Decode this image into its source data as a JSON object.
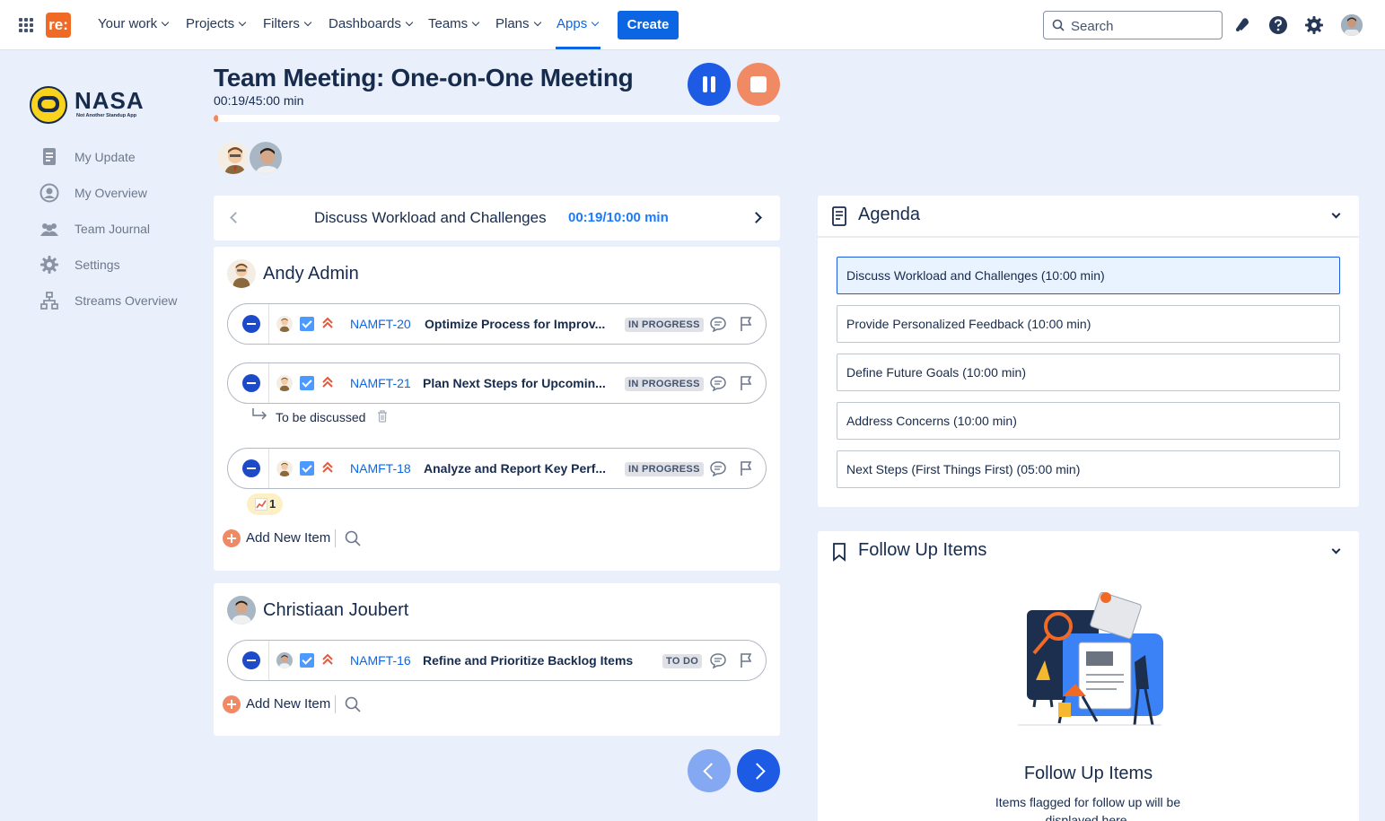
{
  "topnav": {
    "logo_text": "re:",
    "items": [
      {
        "label": "Your work"
      },
      {
        "label": "Projects"
      },
      {
        "label": "Filters"
      },
      {
        "label": "Dashboards"
      },
      {
        "label": "Teams"
      },
      {
        "label": "Plans"
      },
      {
        "label": "Apps",
        "active": true
      }
    ],
    "create_label": "Create",
    "search_placeholder": "Search",
    "icons": [
      "app-switcher-icon",
      "notifications-icon",
      "help-icon",
      "settings-icon",
      "profile-avatar"
    ]
  },
  "sidebar": {
    "logo_text": "NASA",
    "logo_subtitle": "Not Another Standup App",
    "items": [
      {
        "label": "My Update",
        "icon": "document-icon"
      },
      {
        "label": "My Overview",
        "icon": "user-circle-icon"
      },
      {
        "label": "Team Journal",
        "icon": "people-icon"
      },
      {
        "label": "Settings",
        "icon": "gear-icon"
      },
      {
        "label": "Streams Overview",
        "icon": "hierarchy-icon"
      }
    ]
  },
  "meeting": {
    "title": "Team Meeting: One-on-One Meeting",
    "elapsed": "00:19/45:00 min",
    "progress_fraction": 0.007,
    "participants": [
      "Andy Admin",
      "Christiaan Joubert"
    ]
  },
  "topic": {
    "name": "Discuss Workload and Challenges",
    "time": "00:19/10:00 min"
  },
  "people": [
    {
      "name": "Andy Admin",
      "items": [
        {
          "key": "NAMFT-20",
          "summary": "Optimize Process for Improv...",
          "status": "IN PROGRESS"
        },
        {
          "key": "NAMFT-21",
          "summary": "Plan Next Steps for Upcomin...",
          "status": "IN PROGRESS",
          "note": "To be discussed"
        },
        {
          "key": "NAMFT-18",
          "summary": "Analyze and Report Key Perf...",
          "status": "IN PROGRESS",
          "reaction_count": "1"
        }
      ],
      "add_label": "Add New Item"
    },
    {
      "name": "Christiaan Joubert",
      "items": [
        {
          "key": "NAMFT-16",
          "summary": "Refine and Prioritize Backlog Items",
          "status": "TO DO"
        }
      ],
      "add_label": "Add New Item"
    }
  ],
  "agenda": {
    "title": "Agenda",
    "items": [
      {
        "label": "Discuss Workload and Challenges (10:00 min)",
        "active": true
      },
      {
        "label": "Provide Personalized Feedback (10:00 min)"
      },
      {
        "label": "Define Future Goals (10:00 min)"
      },
      {
        "label": "Address Concerns (10:00 min)"
      },
      {
        "label": "Next Steps (First Things First) (05:00 min)"
      }
    ]
  },
  "follow_up": {
    "header": "Follow Up Items",
    "empty_title": "Follow Up Items",
    "empty_desc": "Items flagged for follow up will be displayed here."
  },
  "colors": {
    "brand_blue": "#1d5be5",
    "link_blue": "#0c66e4",
    "accent_orange": "#f08a64",
    "background": "#e9f0fb"
  }
}
